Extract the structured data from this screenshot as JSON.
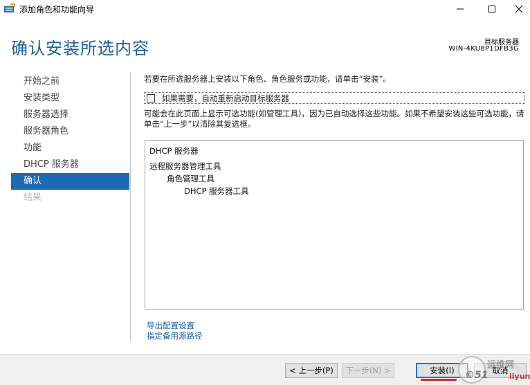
{
  "window": {
    "title": "添加角色和功能向导",
    "minimize_icon": "minimize-icon",
    "maximize_icon": "maximize-icon",
    "close_icon": "close-icon"
  },
  "header": {
    "title": "确认安装所选内容",
    "target_label": "目标服务器",
    "target_server": "WIN-4KU8P1DFB3G"
  },
  "nav": {
    "items": [
      {
        "label": "开始之前",
        "state": "normal"
      },
      {
        "label": "安装类型",
        "state": "normal"
      },
      {
        "label": "服务器选择",
        "state": "normal"
      },
      {
        "label": "服务器角色",
        "state": "normal"
      },
      {
        "label": "功能",
        "state": "normal"
      },
      {
        "label": "DHCP 服务器",
        "state": "normal"
      },
      {
        "label": "确认",
        "state": "active"
      },
      {
        "label": "结果",
        "state": "disabled"
      }
    ]
  },
  "content": {
    "instruction": "若要在所选服务器上安装以下角色、角色服务或功能，请单击“安装”。",
    "restart_label": "如果需要，自动重新启动目标服务器",
    "restart_checked": false,
    "note": "可能会在此页面上显示可选功能(如管理工具)，因为已自动选择这些功能。如果不希望安装这些可选功能，请单击“上一步”以清除其复选框。",
    "selections": [
      {
        "text": "DHCP 服务器",
        "level": 0
      },
      {
        "text": "远程服务器管理工具",
        "level": 0
      },
      {
        "text": "角色管理工具",
        "level": 1
      },
      {
        "text": "DHCP 服务器工具",
        "level": 2
      }
    ],
    "links": {
      "export": "导出配置设置",
      "alt_source": "指定备用源路径"
    }
  },
  "buttons": {
    "prev": "< 上一步(P)",
    "next": "下一步(N) >",
    "install": "安装(I)",
    "cancel": "取消"
  },
  "watermark": {
    "line1": "运维网",
    "line2": "©51",
    "line3": "iiyun"
  },
  "colors": {
    "accent": "#1d5fa0",
    "nav_active": "#1c69b4",
    "highlight": "#d62b2b"
  }
}
